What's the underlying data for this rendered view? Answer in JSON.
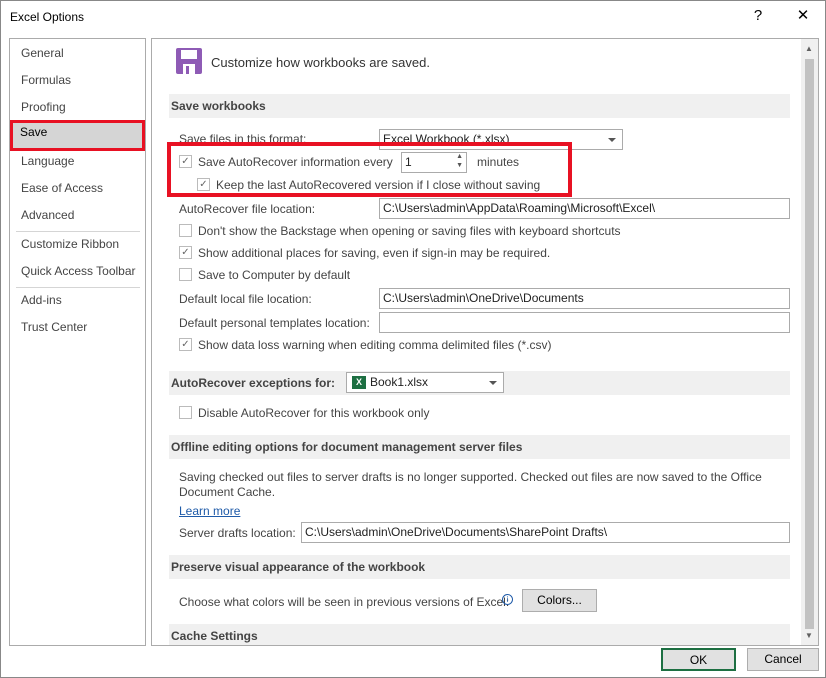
{
  "window": {
    "title": "Excel Options",
    "help": "?",
    "close": "✕"
  },
  "nav": {
    "items": [
      "General",
      "Formulas",
      "Proofing",
      "Save",
      "Language",
      "Ease of Access",
      "Advanced",
      "Customize Ribbon",
      "Quick Access Toolbar",
      "Add-ins",
      "Trust Center"
    ],
    "selected": "Save"
  },
  "header": {
    "title": "Customize how workbooks are saved."
  },
  "save_workbooks": {
    "heading": "Save workbooks",
    "format_label": "Save files in this format:",
    "format_value": "Excel Workbook (*.xlsx)",
    "autorecover_label": "Save AutoRecover information every",
    "autorecover_checked": true,
    "minutes_value": "1",
    "minutes_label": "minutes",
    "keep_last_label": "Keep the last AutoRecovered version if I close without saving",
    "keep_last_checked": true,
    "ar_location_label": "AutoRecover file location:",
    "ar_location_value": "C:\\Users\\admin\\AppData\\Roaming\\Microsoft\\Excel\\",
    "backstage_label": "Don't show the Backstage when opening or saving files with keyboard shortcuts",
    "backstage_checked": false,
    "additional_label": "Show additional places for saving, even if sign-in may be required.",
    "additional_checked": true,
    "computer_label": "Save to Computer by default",
    "computer_checked": false,
    "local_label": "Default local file location:",
    "local_value": "C:\\Users\\admin\\OneDrive\\Documents",
    "templates_label": "Default personal templates location:",
    "templates_value": "",
    "csv_label": "Show data loss warning when editing comma delimited files (*.csv)",
    "csv_checked": true
  },
  "exceptions": {
    "heading": "AutoRecover exceptions for:",
    "workbook": "Book1.xlsx",
    "disable_label": "Disable AutoRecover for this workbook only",
    "disable_checked": false
  },
  "offline": {
    "heading": "Offline editing options for document management server files",
    "text": "Saving checked out files to server drafts is no longer supported. Checked out files are now saved to the Office Document Cache.",
    "learn_more": "Learn more",
    "drafts_label": "Server drafts location:",
    "drafts_value": "C:\\Users\\admin\\OneDrive\\Documents\\SharePoint Drafts\\"
  },
  "preserve": {
    "heading": "Preserve visual appearance of the workbook",
    "colors_label": "Choose what colors will be seen in previous versions of Excel:",
    "colors_button": "Colors..."
  },
  "cache": {
    "heading": "Cache Settings"
  },
  "footer": {
    "ok": "OK",
    "cancel": "Cancel"
  },
  "colors": {
    "highlight": "#e81123",
    "save_icon": "#8e5bb5",
    "excel": "#1d6f42"
  }
}
